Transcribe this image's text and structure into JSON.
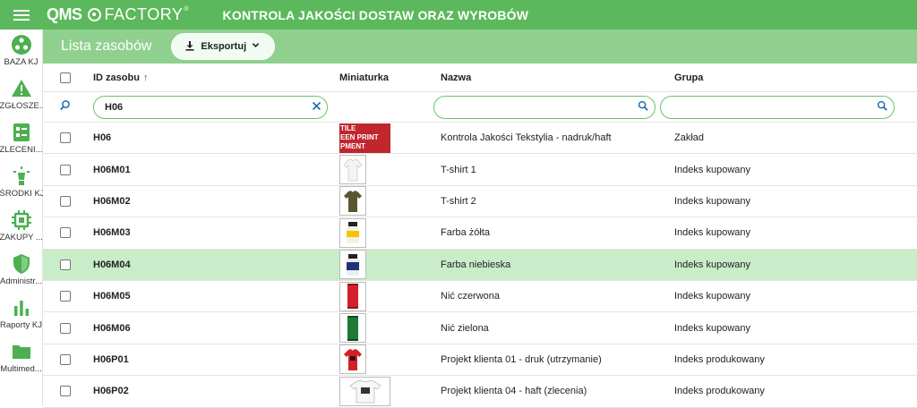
{
  "topbar": {
    "logo_qms": "QMS",
    "logo_factory": "FACTORY",
    "logo_reg": "®",
    "app_title": "KONTROLA JAKOŚCI DOSTAW ORAZ WYROBÓW"
  },
  "sidebar": {
    "items": [
      {
        "label": "BAZA KJ",
        "icon": "network-icon",
        "color": "#4caf50"
      },
      {
        "label": "ZGŁOSZE...",
        "icon": "warning-icon",
        "color": "#4caf50"
      },
      {
        "label": "ZLECENI...",
        "icon": "checklist-icon",
        "color": "#4caf50"
      },
      {
        "label": "ŚRODKI KJ",
        "icon": "lightbulb-icon",
        "color": "#4caf50"
      },
      {
        "label": "ZAKUPY ...",
        "icon": "chip-icon",
        "color": "#4caf50"
      },
      {
        "label": "Administr...",
        "icon": "shield-icon",
        "color": "#4caf50"
      },
      {
        "label": "Raporty KJ",
        "icon": "bar-chart-icon",
        "color": "#4caf50"
      },
      {
        "label": "Multimed...",
        "icon": "folder-icon",
        "color": "#4caf50"
      }
    ]
  },
  "subheader": {
    "title": "Lista zasobów",
    "export_label": "Eksportuj"
  },
  "table": {
    "columns": {
      "id": "ID zasobu",
      "id_sort": "↑",
      "mini": "Miniaturka",
      "name": "Nazwa",
      "group": "Grupa"
    },
    "filters": {
      "id_value": "H06",
      "name_value": "",
      "group_value": ""
    },
    "rows": [
      {
        "id": "H06",
        "thumb": "banner",
        "thumb_text": [
          "TILE",
          "EEN PRINT",
          "PMENT"
        ],
        "name": "Kontrola Jakości Tekstylia - nadruk/haft",
        "group": "Zakład",
        "selected": false
      },
      {
        "id": "H06M01",
        "thumb": "tshirt-white",
        "name": "T-shirt 1",
        "group": "Indeks kupowany",
        "selected": false
      },
      {
        "id": "H06M02",
        "thumb": "tshirt-olive",
        "name": "T-shirt 2",
        "group": "Indeks kupowany",
        "selected": false
      },
      {
        "id": "H06M03",
        "thumb": "paint-yellow",
        "name": "Farba żółta",
        "group": "Indeks kupowany",
        "selected": false
      },
      {
        "id": "H06M04",
        "thumb": "paint-blue",
        "name": "Farba niebieska",
        "group": "Indeks kupowany",
        "selected": true
      },
      {
        "id": "H06M05",
        "thumb": "thread-red",
        "name": "Nić czerwona",
        "group": "Indeks kupowany",
        "selected": false
      },
      {
        "id": "H06M06",
        "thumb": "thread-green",
        "name": "Nić zielona",
        "group": "Indeks kupowany",
        "selected": false
      },
      {
        "id": "H06P01",
        "thumb": "tshirt-red",
        "name": "Projekt klienta 01 - druk (utrzymanie)",
        "group": "Indeks produkowany",
        "selected": false
      },
      {
        "id": "H06P02",
        "thumb": "tshirt-print",
        "name": "Projekt klienta 04 - haft (zlecenia)",
        "group": "Indeks produkowany",
        "selected": false
      }
    ]
  }
}
